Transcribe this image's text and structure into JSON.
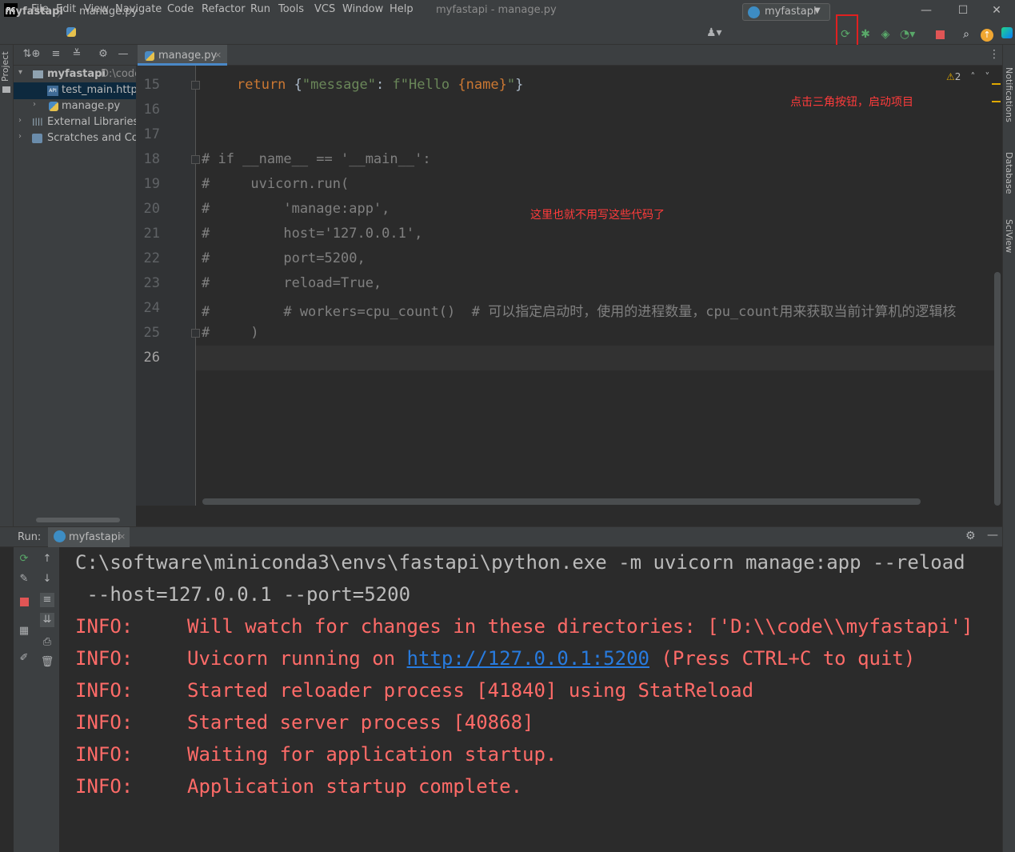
{
  "titlebar": {
    "logo": "PC",
    "menus": [
      "File",
      "Edit",
      "View",
      "Navigate",
      "Code",
      "Refactor",
      "Run",
      "Tools",
      "VCS",
      "Window",
      "Help"
    ],
    "window_title": "myfastapi - manage.py",
    "minimize": "—",
    "maximize": "☐",
    "close": "✕"
  },
  "navbar": {
    "project": "myfastapi",
    "separator": "〉",
    "file": "manage.py",
    "run_config": "myfastapi",
    "icons": [
      "user-icon",
      "rerun-icon",
      "debug-icon",
      "coverage-icon",
      "profile-icon",
      "stop-icon",
      "search-icon",
      "update-icon",
      "jetbrains-icon"
    ]
  },
  "project_panel": {
    "tab_label": "Project",
    "tree": [
      {
        "label": "myfastapi",
        "path": "D:\\code",
        "expanded": true
      },
      {
        "label": "test_main.http",
        "selected": true
      },
      {
        "label": "manage.py"
      },
      {
        "label": "External Libraries"
      },
      {
        "label": "Scratches and Consoles"
      }
    ]
  },
  "editor": {
    "tab_label": "manage.py",
    "tab_close": "×",
    "warnings": "2",
    "lines": [
      {
        "n": "15"
      },
      {
        "n": "16"
      },
      {
        "n": "17"
      },
      {
        "n": "18"
      },
      {
        "n": "19"
      },
      {
        "n": "20"
      },
      {
        "n": "21"
      },
      {
        "n": "22"
      },
      {
        "n": "23"
      },
      {
        "n": "24"
      },
      {
        "n": "25"
      },
      {
        "n": "26"
      }
    ],
    "code": {
      "l15_kw": "return",
      "l15_a": " {",
      "l15_s1": "\"message\"",
      "l15_b": ": ",
      "l15_s2": "f\"Hello ",
      "l15_v": "{name}",
      "l15_s3": "\"",
      "l15_c": "}",
      "l18": "# if __name__ == '__main__':",
      "l19": "#     uvicorn.run(",
      "l20": "#         'manage:app',",
      "l21": "#         host='127.0.0.1',",
      "l22": "#         port=5200,",
      "l23": "#         reload=True,",
      "l24": "#         # workers=cpu_count()  # 可以指定启动时，使用的进程数量，cpu_count用来获取当前计算机的逻辑核",
      "l25": "#     )"
    },
    "annotation_run": "点击三角按钮，启动项目",
    "annotation_code": "这里也就不用写这些代码了"
  },
  "right_stripe": {
    "tabs": [
      "Notifications",
      "Database",
      "SciView"
    ]
  },
  "run_panel": {
    "label": "Run:",
    "tab_label": "myfastapi",
    "tab_close": "×",
    "console": {
      "cmd1": "C:\\software\\miniconda3\\envs\\fastapi\\python.exe -m uvicorn manage:app --reload",
      "cmd2": " --host=127.0.0.1 --port=5200",
      "info_prefix": "INFO:",
      "l1": "Will watch for changes in these directories: ['D:\\\\code\\\\myfastapi']",
      "l2_pre": "Uvicorn running on ",
      "l2_link": "http://127.0.0.1:5200",
      "l2_post": " (Press CTRL+C to quit)",
      "l3": "Started reloader process [41840] using StatReload",
      "l4": "Started server process [40868]",
      "l5": "Waiting for application startup.",
      "l6": "Application startup complete."
    }
  },
  "colors": {
    "accent": "#4a88c7",
    "annotation": "#ff3b3b",
    "console_info": "#ff6b68",
    "link": "#287bde",
    "keyword": "#cc7832",
    "string": "#6a8759",
    "comment": "#808080"
  }
}
